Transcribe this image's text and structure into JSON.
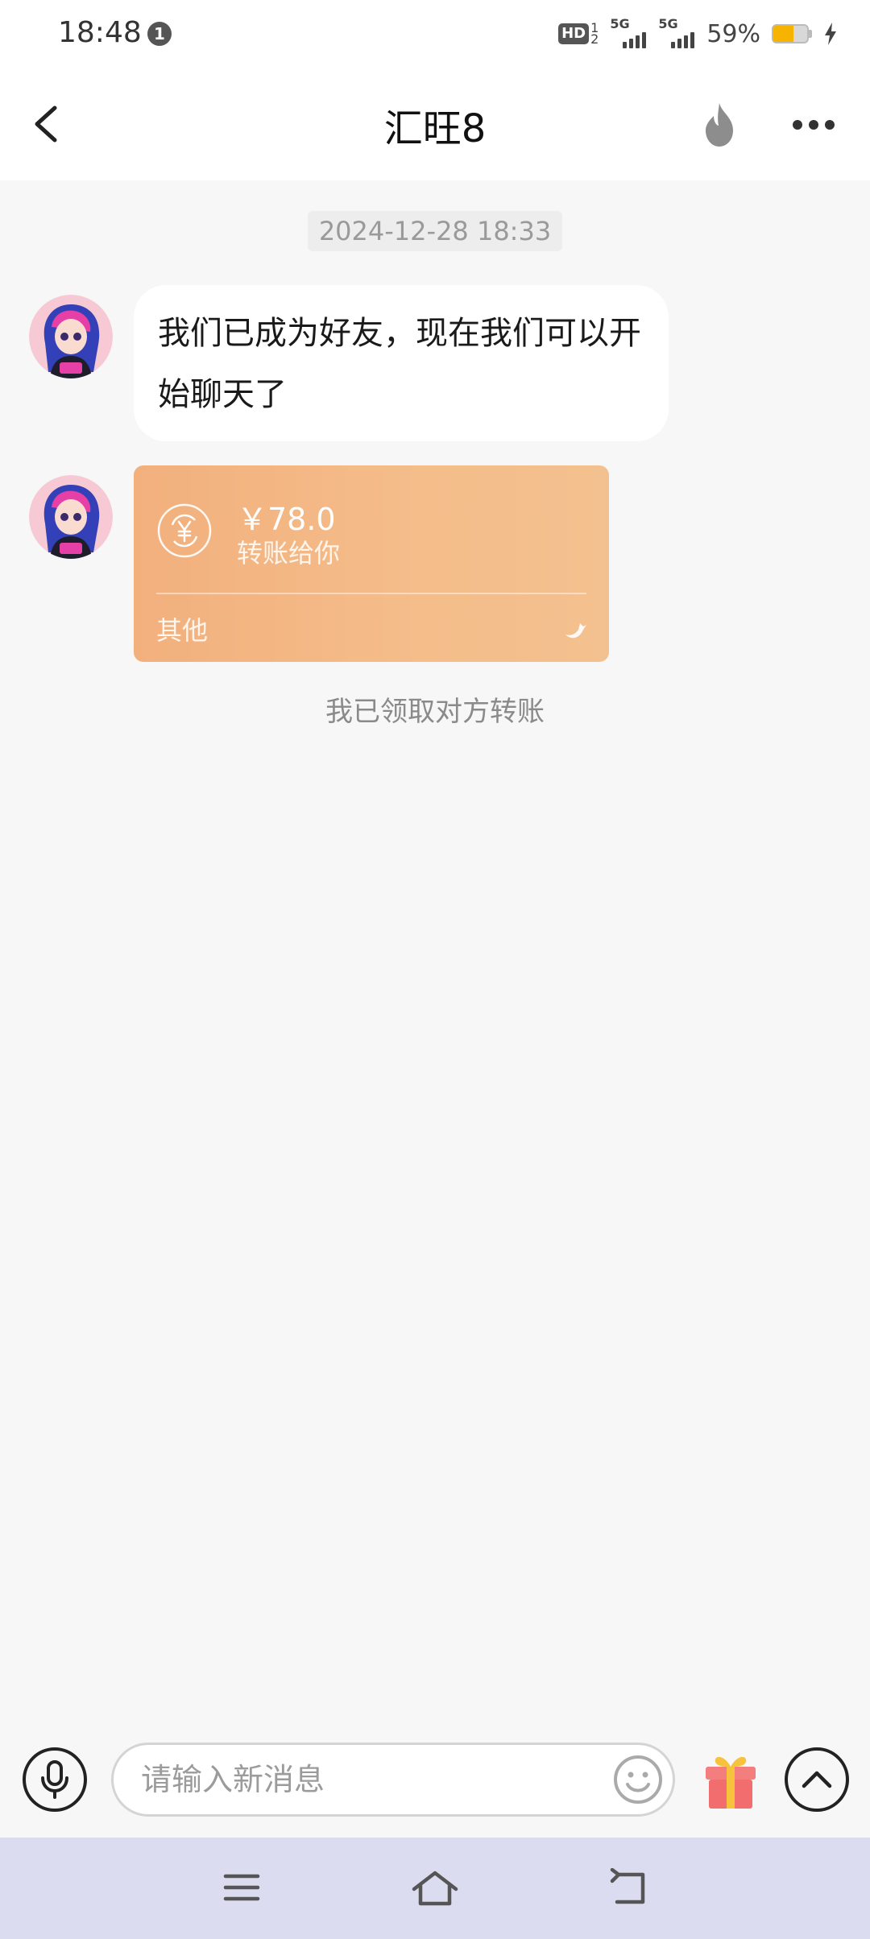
{
  "status_bar": {
    "time": "18:48",
    "notification_count": "1",
    "hd_label": "HD",
    "hd_sub_top": "1",
    "hd_sub_bottom": "2",
    "network_1": "5G",
    "network_2": "5G",
    "battery_percent": "59%",
    "battery_level": 0.59
  },
  "header": {
    "title": "汇旺8"
  },
  "conversation": {
    "timestamp": "2024-12-28 18:33",
    "messages": [
      {
        "type": "text",
        "text": "我们已成为好友，现在我们可以开始聊天了"
      },
      {
        "type": "transfer",
        "amount": "￥78.0",
        "description": "转账给你",
        "footer": "其他"
      }
    ],
    "receipt_note": "我已领取对方转账"
  },
  "input_bar": {
    "placeholder": "请输入新消息",
    "value": ""
  },
  "icons": {
    "back": "chevron-left-icon",
    "fire": "fire-icon",
    "more": "more-dots-icon",
    "mic": "microphone-icon",
    "emoji": "smiley-icon",
    "gift": "gift-icon",
    "expand": "chevron-up-icon"
  },
  "colors": {
    "transfer_card": "#f3b887",
    "gift_red": "#f26d6d",
    "gift_ribbon": "#f7c23c",
    "nav_bar": "#dcdcf0"
  }
}
